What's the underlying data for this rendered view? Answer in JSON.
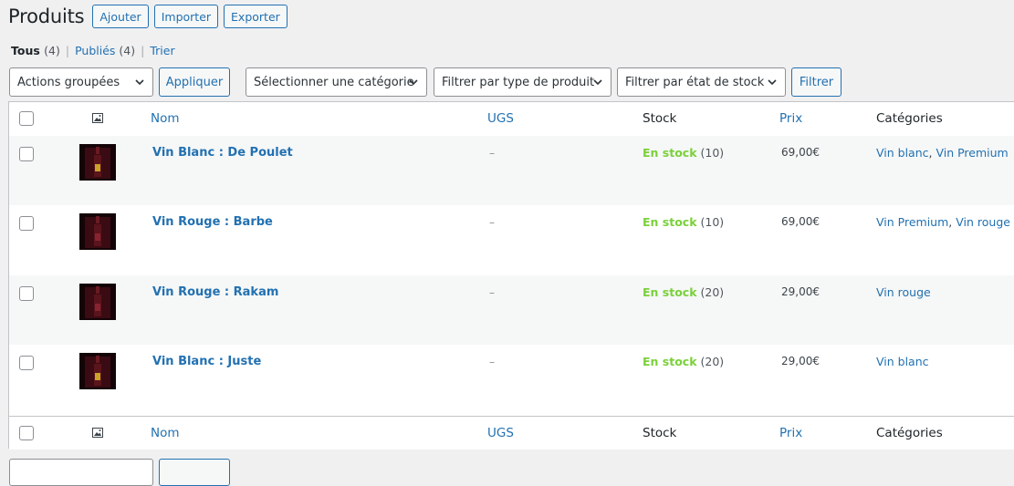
{
  "header": {
    "title": "Produits",
    "actions": [
      "Ajouter",
      "Importer",
      "Exporter"
    ]
  },
  "views": {
    "all_label": "Tous",
    "all_count": "(4)",
    "published_label": "Publiés",
    "published_count": "(4)",
    "sort_label": "Trier",
    "separator": "|"
  },
  "filters": {
    "bulk_actions": "Actions groupées",
    "apply": "Appliquer",
    "category": "Sélectionner une catégorie",
    "product_type": "Filtrer par type de produit",
    "stock_status": "Filtrer par état de stock",
    "filter": "Filtrer"
  },
  "table": {
    "columns": {
      "name": "Nom",
      "sku": "UGS",
      "stock": "Stock",
      "price": "Prix",
      "categories": "Catégories"
    },
    "rows": [
      {
        "name": "Vin Blanc : De Poulet",
        "sku": "–",
        "stock_status": "En stock",
        "stock_qty": "(10)",
        "price": "69,00€",
        "categories": [
          "Vin blanc",
          "Vin Premium"
        ],
        "thumb_color": "#c9a227"
      },
      {
        "name": "Vin Rouge : Barbe",
        "sku": "–",
        "stock_status": "En stock",
        "stock_qty": "(10)",
        "price": "69,00€",
        "categories": [
          "Vin Premium",
          "Vin rouge"
        ],
        "thumb_color": "#8a2330"
      },
      {
        "name": "Vin Rouge : Rakam",
        "sku": "–",
        "stock_status": "En stock",
        "stock_qty": "(20)",
        "price": "29,00€",
        "categories": [
          "Vin rouge"
        ],
        "thumb_color": "#8a2330"
      },
      {
        "name": "Vin Blanc : Juste",
        "sku": "–",
        "stock_status": "En stock",
        "stock_qty": "(20)",
        "price": "29,00€",
        "categories": [
          "Vin blanc"
        ],
        "thumb_color": "#c9a227"
      }
    ]
  },
  "colors": {
    "accent": "#2271b1",
    "in_stock": "#7ad03a",
    "background": "#f0f0f1"
  },
  "icons": [
    "image-icon",
    "chevron-down-icon",
    "checkbox"
  ]
}
